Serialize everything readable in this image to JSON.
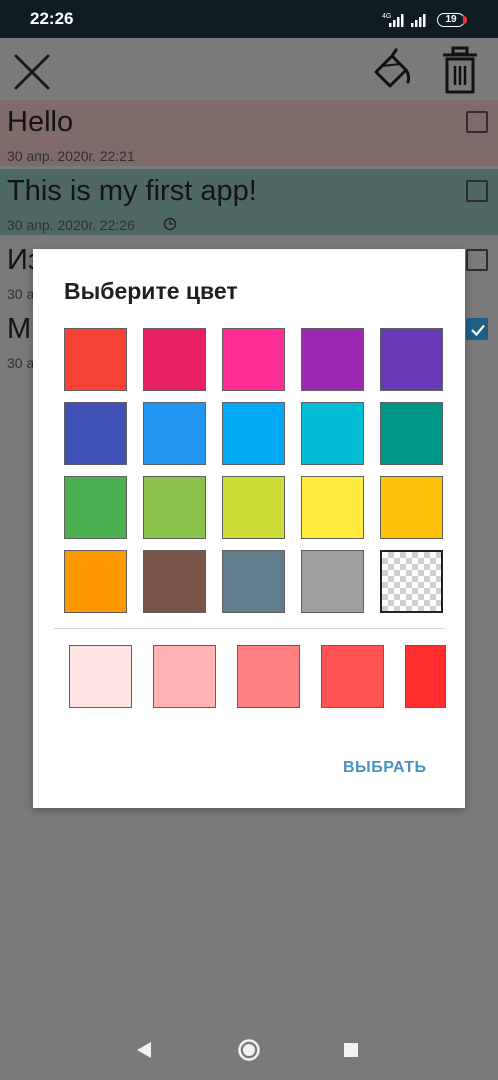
{
  "status_bar": {
    "time": "22:26",
    "network": "4G",
    "battery": "19",
    "icons": [
      "signal-icon",
      "signal-icon",
      "battery-icon"
    ]
  },
  "toolbar": {
    "icons": [
      "close-icon",
      "paint-bucket-icon",
      "trash-icon"
    ]
  },
  "notes": [
    {
      "title": "Hello",
      "date": "30 апр. 2020г. 22:21",
      "color": "#806b6b",
      "checked": false,
      "reminder": false
    },
    {
      "title": "This is my first app!",
      "date": "30 апр. 2020г. 22:26",
      "color": "#4e6865",
      "checked": false,
      "reminder": true
    },
    {
      "title": "Из",
      "date": "30 а",
      "color": "#7a7a7a",
      "checked": false,
      "reminder": false
    },
    {
      "title": "М",
      "date": "30 а",
      "color": "#7a7a7a",
      "checked": true,
      "reminder": false
    }
  ],
  "dialog": {
    "title": "Выберите цвет",
    "confirm_label": "ВЫБРАТЬ",
    "palette": [
      "#f44336",
      "#e91e63",
      "#ff2d94",
      "#9c27b0",
      "#673ab7",
      "#3f51b5",
      "#2196f3",
      "#03a9f4",
      "#00bcd4",
      "#009688",
      "#4caf50",
      "#8bc34a",
      "#cddc39",
      "#ffeb3b",
      "#ffc107",
      "#ff9800",
      "#795548",
      "#607d8b",
      "#9e9e9e",
      "transparent"
    ],
    "shades": [
      "#ffe4e4",
      "#ffb3b3",
      "#ff8080",
      "#ff5252",
      "#ff2d2d"
    ]
  },
  "nav_bar": {
    "icons": [
      "back-icon",
      "home-icon",
      "recents-icon"
    ]
  }
}
